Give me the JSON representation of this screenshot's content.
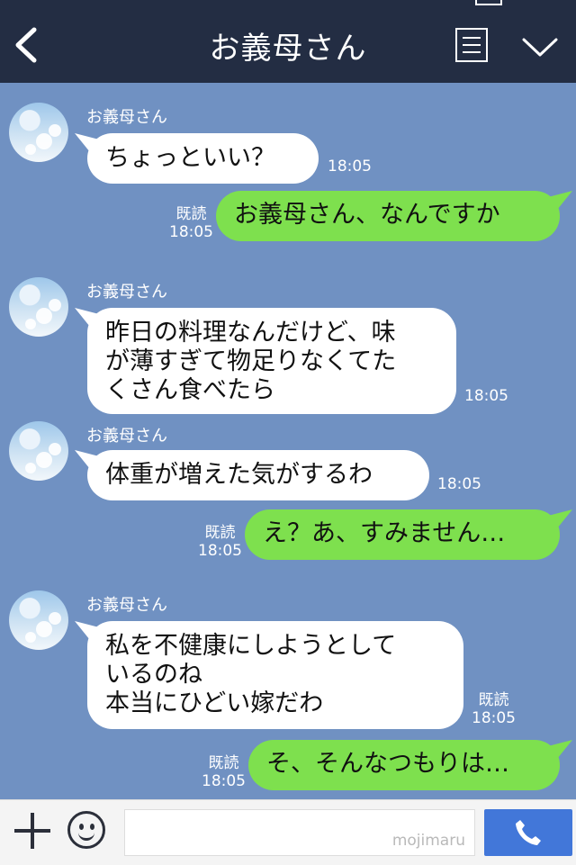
{
  "header": {
    "title": "お義母さん",
    "back_icon": "chevron-left-icon",
    "menu_icon": "menu-list-icon",
    "dropdown_icon": "chevron-down-icon"
  },
  "colors": {
    "header_bg": "#232d43",
    "chat_bg": "#7091c2",
    "outgoing_bubble": "#7ee04e",
    "incoming_bubble": "#ffffff",
    "call_button": "#4277d9"
  },
  "messages": [
    {
      "sender": "お義母さん",
      "lines": [
        "ちょっといい？"
      ],
      "time": "18:05"
    },
    {
      "lines": [
        "お義母さん、なんですか"
      ],
      "read": "既読",
      "time": "18:05"
    },
    {
      "sender": "お義母さん",
      "lines": [
        "昨日の料理なんだけど、味",
        "が薄すぎて物足りなくてた",
        "くさん食べたら"
      ],
      "time": "18:05"
    },
    {
      "sender": "お義母さん",
      "lines": [
        "体重が増えた気がするわ"
      ],
      "time": "18:05"
    },
    {
      "lines": [
        "え？あ、すみません…"
      ],
      "read": "既読",
      "time": "18:05"
    },
    {
      "sender": "お義母さん",
      "lines": [
        "私を不健康にしようとして",
        "いるのね",
        "本当にひどい嫁だわ"
      ],
      "read": "既読",
      "time": "18:05"
    },
    {
      "lines": [
        "そ、そんなつもりは…"
      ],
      "read": "既読",
      "time": "18:05"
    }
  ],
  "footer": {
    "plus_icon": "plus-icon",
    "sticker_icon": "smiley-icon",
    "input_value": "",
    "watermark": "mojimaru",
    "call_icon": "phone-icon"
  }
}
